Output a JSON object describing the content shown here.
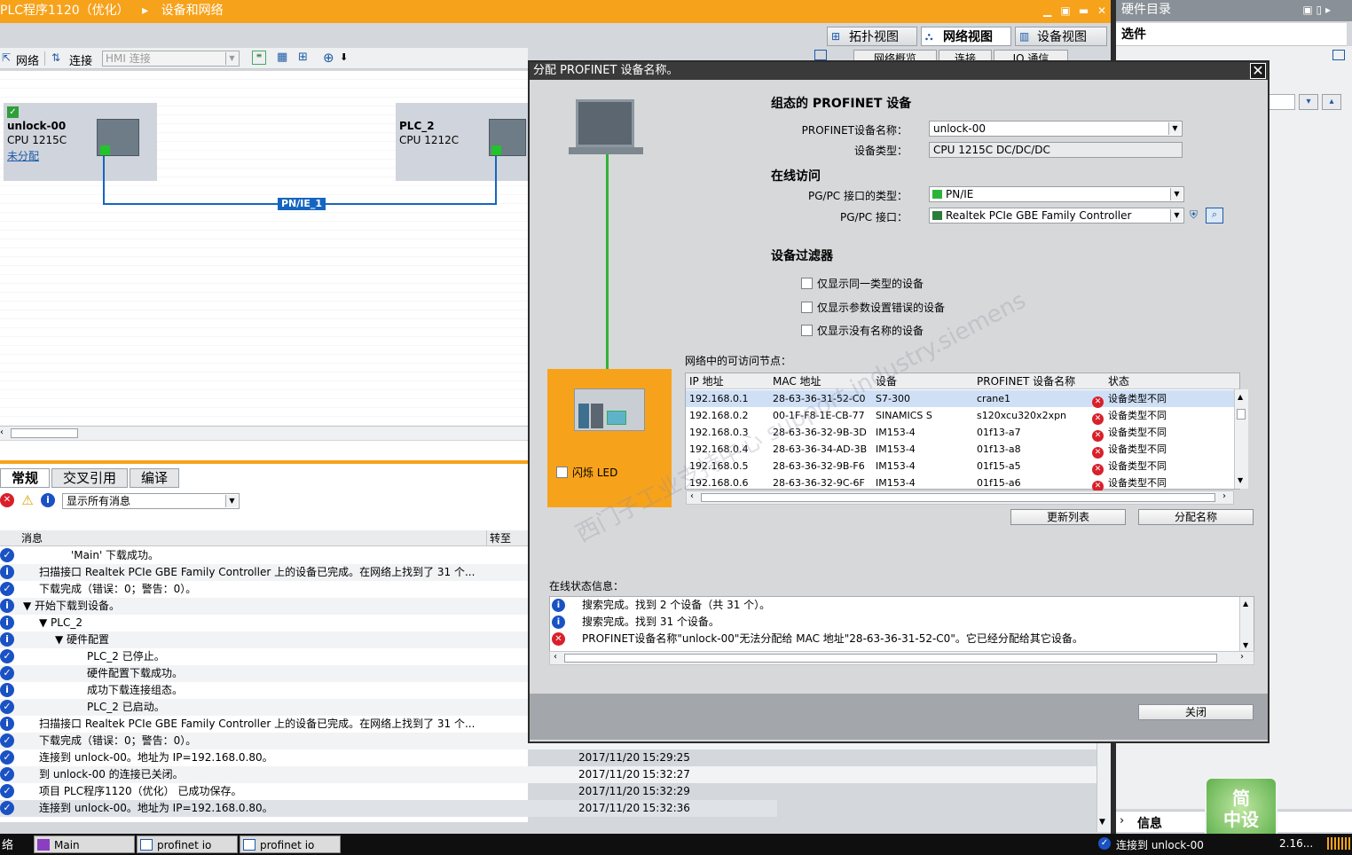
{
  "titlebar": {
    "crumb1": "PLC程序1120（优化）",
    "arrow": "▸",
    "crumb2": "设备和网络",
    "min": "▁",
    "restore": "▣",
    "max": "▬",
    "close": "✕"
  },
  "hwcatalog": {
    "title": "硬件目录",
    "subtitle": "选件",
    "icons": "▣ ▯ ▸"
  },
  "views": {
    "topology": "拓扑视图",
    "network": "网络视图",
    "device": "设备视图"
  },
  "toolbar": {
    "network": "网络",
    "connections": "连接",
    "hmi_placeholder": "HMI 连接"
  },
  "overview_tabs": [
    "网络概览",
    "连接",
    "IO 通信"
  ],
  "devices": [
    {
      "name": "unlock-00",
      "cpu": "CPU 1215C",
      "link": "未分配"
    },
    {
      "name": "PLC_2",
      "cpu": "CPU 1212C"
    }
  ],
  "network_label": "PN/IE_1",
  "inspector": {
    "tabs": [
      "常规",
      "交叉引用",
      "编译"
    ],
    "filter": "显示所有消息",
    "col_message": "消息",
    "col_goto": "转至",
    "messages": [
      {
        "icon": "ok",
        "indent": 80,
        "text": "'Main' 下载成功。",
        "date": "",
        "time": ""
      },
      {
        "icon": "info",
        "indent": 44,
        "text": "扫描接口 Realtek PCIe GBE Family Controller 上的设备已完成。在网络上找到了 31 个...",
        "date": "",
        "time": ""
      },
      {
        "icon": "ok",
        "indent": 44,
        "text": "下载完成（错误：0；警告：0）。",
        "date": "",
        "time": ""
      },
      {
        "icon": "info",
        "indent": 26,
        "text": "▼  开始下载到设备。",
        "date": "",
        "time": ""
      },
      {
        "icon": "info",
        "indent": 44,
        "text": "▼  PLC_2",
        "date": "",
        "time": ""
      },
      {
        "icon": "info",
        "indent": 62,
        "text": "▼  硬件配置",
        "date": "",
        "time": ""
      },
      {
        "icon": "ok",
        "indent": 98,
        "text": "PLC_2 已停止。",
        "date": "",
        "time": ""
      },
      {
        "icon": "ok",
        "indent": 98,
        "text": "硬件配置下载成功。",
        "date": "",
        "time": ""
      },
      {
        "icon": "info",
        "indent": 98,
        "text": "成功下载连接组态。",
        "date": "",
        "time": ""
      },
      {
        "icon": "ok",
        "indent": 98,
        "text": "PLC_2 已启动。",
        "date": "",
        "time": ""
      },
      {
        "icon": "info",
        "indent": 44,
        "text": "扫描接口 Realtek PCIe GBE Family Controller 上的设备已完成。在网络上找到了 31 个...",
        "date": "",
        "time": ""
      },
      {
        "icon": "ok",
        "indent": 44,
        "text": "下载完成（错误：0；警告：0）。",
        "date": "",
        "time": ""
      },
      {
        "icon": "ok",
        "indent": 44,
        "text": "连接到 unlock-00。地址为 IP=192.168.0.80。",
        "date": "2017/11/20",
        "time": "15:29:25"
      },
      {
        "icon": "ok",
        "indent": 44,
        "text": "到 unlock-00 的连接已关闭。",
        "date": "2017/11/20",
        "time": "15:32:27"
      },
      {
        "icon": "ok",
        "indent": 44,
        "text": "项目 PLC程序1120（优化） 已成功保存。",
        "date": "2017/11/20",
        "time": "15:32:29"
      },
      {
        "icon": "ok",
        "indent": 44,
        "text": "连接到 unlock-00。地址为 IP=192.168.0.80。",
        "date": "2017/11/20",
        "time": "15:32:36"
      }
    ]
  },
  "dialog": {
    "title": "分配 PROFINET 设备名称。",
    "close": "✕",
    "sec_configured": "组态的 PROFINET 设备",
    "lbl_name": "PROFINET设备名称：",
    "val_name": "unlock-00",
    "lbl_type": "设备类型：",
    "val_type": "CPU 1215C DC/DC/DC",
    "sec_online": "在线访问",
    "lbl_iftype": "PG/PC 接口的类型：",
    "val_iftype": "PN/IE",
    "lbl_if": "PG/PC 接口：",
    "val_if": "Realtek PCIe GBE Family Controller",
    "sec_filter": "设备过滤器",
    "filters": [
      "仅显示同一类型的设备",
      "仅显示参数设置错误的设备",
      "仅显示没有名称的设备"
    ],
    "nodes_label": "网络中的可访问节点：",
    "columns": [
      "IP 地址",
      "MAC 地址",
      "设备",
      "PROFINET 设备名称",
      "状态"
    ],
    "nodes": [
      {
        "ip": "192.168.0.1",
        "mac": "28-63-36-31-52-C0",
        "dev": "S7-300",
        "name": "crane1",
        "status": "设备类型不同"
      },
      {
        "ip": "192.168.0.2",
        "mac": "00-1F-F8-1E-CB-77",
        "dev": "SINAMICS S",
        "name": "s120xcu320x2xpn",
        "status": "设备类型不同"
      },
      {
        "ip": "192.168.0.3",
        "mac": "28-63-36-32-9B-3D",
        "dev": "IM153-4",
        "name": "01f13-a7",
        "status": "设备类型不同"
      },
      {
        "ip": "192.168.0.4",
        "mac": "28-63-36-34-AD-3B",
        "dev": "IM153-4",
        "name": "01f13-a8",
        "status": "设备类型不同"
      },
      {
        "ip": "192.168.0.5",
        "mac": "28-63-36-32-9B-F6",
        "dev": "IM153-4",
        "name": "01f15-a5",
        "status": "设备类型不同"
      },
      {
        "ip": "192.168.0.6",
        "mac": "28-63-36-32-9C-6F",
        "dev": "IM153-4",
        "name": "01f15-a6",
        "status": "设备类型不同"
      }
    ],
    "led": "闪烁 LED",
    "btn_update": "更新列表",
    "btn_assign": "分配名称",
    "status_label": "在线状态信息：",
    "status": [
      {
        "icon": "info",
        "text": "搜索完成。找到 2 个设备（共 31 个）。"
      },
      {
        "icon": "info",
        "text": "搜索完成。找到 31 个设备。"
      },
      {
        "icon": "err",
        "text": "PROFINET设备名称\"unlock-00\"无法分配给 MAC 地址\"28-63-36-31-52-C0\"。它已经分配给其它设备。"
      }
    ],
    "btn_close": "关闭"
  },
  "info_panel": "信息",
  "taskbar": {
    "left": "络",
    "tasks": [
      "Main",
      "profinet io",
      "profinet io"
    ],
    "status": "连接到 unlock-00",
    "right": "2.16..."
  },
  "badge": {
    "line1": "简",
    "line2": "中设"
  },
  "watermark": "西门子工业支持中心 support.industry.siemens"
}
